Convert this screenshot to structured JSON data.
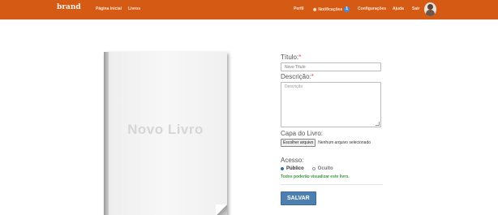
{
  "navbar": {
    "brand": "brand",
    "links": {
      "my_page": "Página Inicial",
      "books": "Livros",
      "profile": "Perfil",
      "notifications": "Notificações",
      "notifications_count": "1",
      "settings": "Configurações",
      "help": "Ajuda",
      "logout": "Sair"
    },
    "accent_color": "#d55a14"
  },
  "book_cover": {
    "title": "Novo Livro"
  },
  "form": {
    "title_label": "Título:",
    "title_required": "*",
    "title_placeholder": "Novo Título",
    "description_label": "Descrição:",
    "description_required": "*",
    "description_placeholder": "Descrição",
    "cover_label": "Capa do Livro:",
    "file_button": "Escolher arquivo",
    "file_status": "Nenhum arquivo selecionado",
    "access_label": "Acesso:",
    "access_options": {
      "public": "Público",
      "hidden": "Oculto"
    },
    "access_selected": "Público",
    "help_text": "Todos poderão visualizar este livro.",
    "save_button": "SALVAR"
  }
}
